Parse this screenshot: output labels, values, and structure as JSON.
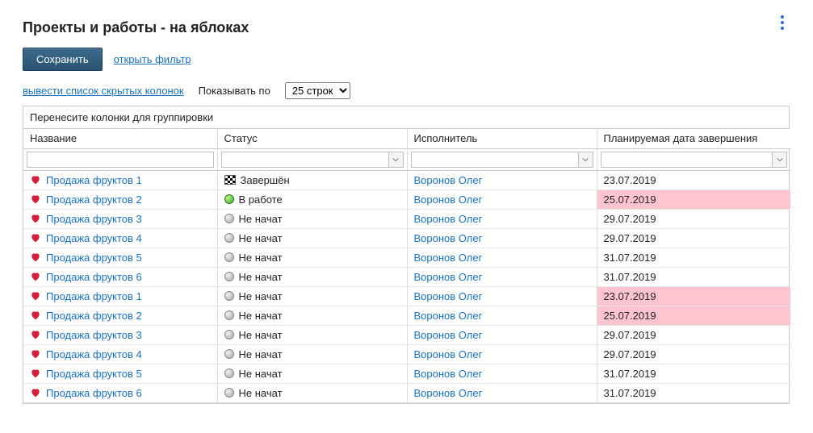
{
  "title": "Проекты и работы - на яблоках",
  "save_label": "Сохранить",
  "open_filter_label": "открыть фильтр",
  "show_hidden_cols_label": "вывести список скрытых колонок",
  "show_per_label": "Показывать по",
  "page_size_value": "25 строк",
  "group_bar_text": "Перенесите колонки для группировки",
  "columns": {
    "name": "Название",
    "status": "Статус",
    "assignee": "Исполнитель",
    "due": "Планируемая дата завершения"
  },
  "filters": {
    "name": "",
    "status": "",
    "assignee": "",
    "due": ""
  },
  "status_text": {
    "done": "Завершён",
    "in_progress": "В работе",
    "not_started": "Не начат"
  },
  "rows": [
    {
      "name": "Продажа фруктов 1",
      "status": "done",
      "assignee": "Воронов Олег",
      "due": "23.07.2019",
      "highlight": false
    },
    {
      "name": "Продажа фруктов 2",
      "status": "in_progress",
      "assignee": "Воронов Олег",
      "due": "25.07.2019",
      "highlight": true
    },
    {
      "name": "Продажа фруктов 3",
      "status": "not_started",
      "assignee": "Воронов Олег",
      "due": "29.07.2019",
      "highlight": false
    },
    {
      "name": "Продажа фруктов 4",
      "status": "not_started",
      "assignee": "Воронов Олег",
      "due": "29.07.2019",
      "highlight": false
    },
    {
      "name": "Продажа фруктов 5",
      "status": "not_started",
      "assignee": "Воронов Олег",
      "due": "31.07.2019",
      "highlight": false
    },
    {
      "name": "Продажа фруктов 6",
      "status": "not_started",
      "assignee": "Воронов Олег",
      "due": "31.07.2019",
      "highlight": false
    },
    {
      "name": "Продажа фруктов 1",
      "status": "not_started",
      "assignee": "Воронов Олег",
      "due": "23.07.2019",
      "highlight": true
    },
    {
      "name": "Продажа фруктов 2",
      "status": "not_started",
      "assignee": "Воронов Олег",
      "due": "25.07.2019",
      "highlight": true
    },
    {
      "name": "Продажа фруктов 3",
      "status": "not_started",
      "assignee": "Воронов Олег",
      "due": "29.07.2019",
      "highlight": false
    },
    {
      "name": "Продажа фруктов 4",
      "status": "not_started",
      "assignee": "Воронов Олег",
      "due": "29.07.2019",
      "highlight": false
    },
    {
      "name": "Продажа фруктов 5",
      "status": "not_started",
      "assignee": "Воронов Олег",
      "due": "31.07.2019",
      "highlight": false
    },
    {
      "name": "Продажа фруктов 6",
      "status": "not_started",
      "assignee": "Воронов Олег",
      "due": "31.07.2019",
      "highlight": false
    }
  ]
}
